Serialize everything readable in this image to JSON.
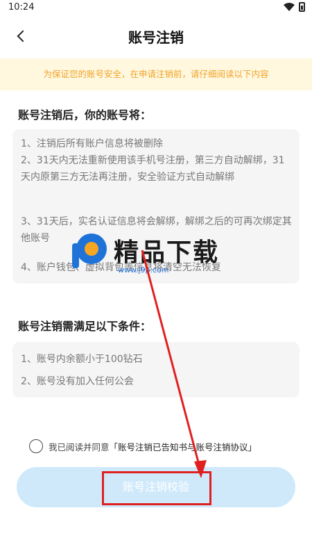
{
  "status_bar": {
    "time": "10:24"
  },
  "header": {
    "title": "账号注销"
  },
  "notice": {
    "text": "为保证您的账号安全，在申请注销前，请仔细阅读以下内容"
  },
  "section1": {
    "heading": "账号注销后，你的账号将：",
    "items": [
      "1、注销后所有账户信息将被删除",
      "2、31天内无法重新使用该手机号注册，第三方自动解绑，31天内原第三方无法再注册，安全验证方式自动解绑",
      "3、31天后，实名认证信息将会解绑，解绑之后的可再次绑定其他账号",
      "4、账户钱包、虚拟背包等信息将清空无法恢复"
    ]
  },
  "section2": {
    "heading": "账号注销需满足以下条件：",
    "items": [
      "1、账号内余额小于100钻石",
      "2、账号没有加入任何公会"
    ]
  },
  "agreement": {
    "prefix": "我已阅读并同意",
    "link": "「账号注销已告知书与账号注销协议」"
  },
  "confirm_button": {
    "label": "账号注销校验"
  },
  "watermark": {
    "title": "精品下载",
    "url": "www.j9p.com"
  },
  "colors": {
    "notice_bg": "#fff8de",
    "notice_text": "#f0a32c",
    "button_bg": "#cfe9fb",
    "annotation": "#e0201f"
  }
}
